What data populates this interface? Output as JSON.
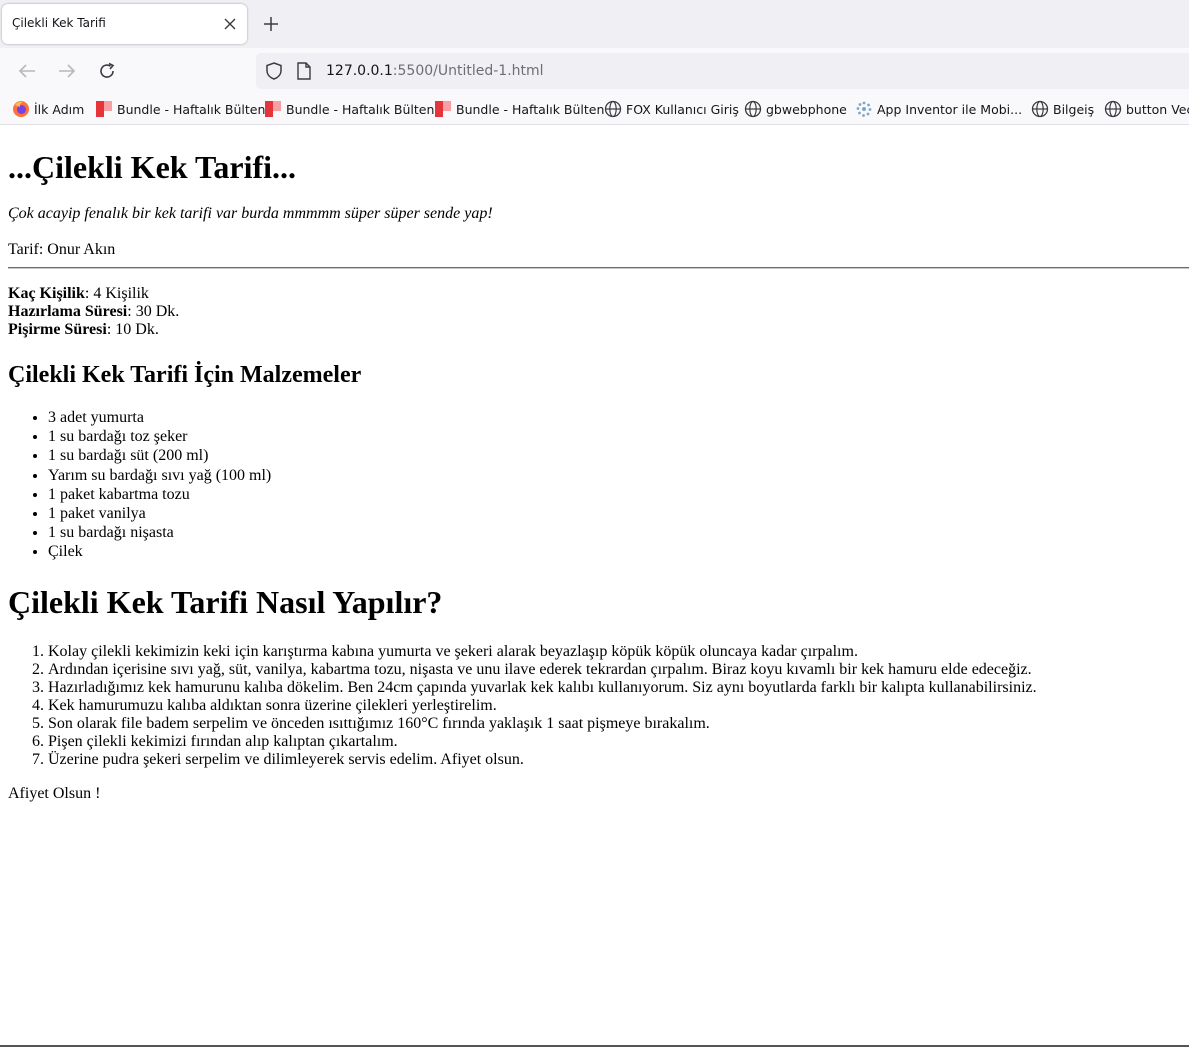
{
  "browser": {
    "tab": {
      "title": "Çilekli Kek Tarifi"
    },
    "url": {
      "host": "127.0.0.1",
      "rest": ":5500/Untitled-1.html"
    },
    "bookmarks": [
      {
        "label": "İlk Adım",
        "icon": "firefox-icon"
      },
      {
        "label": "Bundle - Haftalık Bülten",
        "icon": "bundle-icon"
      },
      {
        "label": "Bundle - Haftalık Bülten",
        "icon": "bundle-icon"
      },
      {
        "label": "Bundle - Haftalık Bülten",
        "icon": "bundle-icon"
      },
      {
        "label": "FOX Kullanıcı Giriş",
        "icon": "globe-icon"
      },
      {
        "label": "gbwebphone",
        "icon": "globe-icon"
      },
      {
        "label": "App Inventor ile Mobi...",
        "icon": "app-inventor-icon"
      },
      {
        "label": "Bilgeiş",
        "icon": "globe-icon"
      },
      {
        "label": "button Vec",
        "icon": "globe-icon"
      }
    ]
  },
  "page": {
    "title": "...Çilekli Kek Tarifi...",
    "subtitle": "Çok acayip fenalık bir kek tarifi var burda mmmmm süper süper sende yap!",
    "author": "Tarif: Onur Akın",
    "meta": [
      {
        "label": "Kaç Kişilik",
        "value": ": 4 Kişilik"
      },
      {
        "label": "Hazırlama Süresi",
        "value": ": 30 Dk."
      },
      {
        "label": "Pişirme Süresi",
        "value": ": 10 Dk."
      }
    ],
    "ingredients_title": "Çilekli Kek Tarifi İçin Malzemeler",
    "ingredients": [
      "3 adet yumurta",
      "1 su bardağı toz şeker",
      "1 su bardağı süt (200 ml)",
      "Yarım su bardağı sıvı yağ (100 ml)",
      "1 paket kabartma tozu",
      "1 paket vanilya",
      "1 su bardağı nişasta",
      "Çilek"
    ],
    "steps_title": "Çilekli Kek Tarifi Nasıl Yapılır?",
    "steps": [
      "Kolay çilekli kekimizin keki için karıştırma kabına yumurta ve şekeri alarak beyazlaşıp köpük köpük oluncaya kadar çırpalım.",
      "Ardından içerisine sıvı yağ, süt, vanilya, kabartma tozu, nişasta ve unu ilave ederek tekrardan çırpalım. Biraz koyu kıvamlı bir kek hamuru elde edeceğiz.",
      "Hazırladığımız kek hamurunu kalıba dökelim. Ben 24cm çapında yuvarlak kek kalıbı kullanıyorum. Siz aynı boyutlarda farklı bir kalıpta kullanabilirsiniz.",
      "Kek hamurumuzu kalıba aldıktan sonra üzerine çilekleri yerleştirelim.",
      "Son olarak file badem serpelim ve önceden ısıttığımız 160°C fırında yaklaşık 1 saat pişmeye bırakalım.",
      "Pişen çilekli kekimizi fırından alıp kalıptan çıkartalım.",
      "Üzerine pudra şekeri serpelim ve dilimleyerek servis edelim. Afiyet olsun."
    ],
    "closing": "Afiyet Olsun !"
  }
}
